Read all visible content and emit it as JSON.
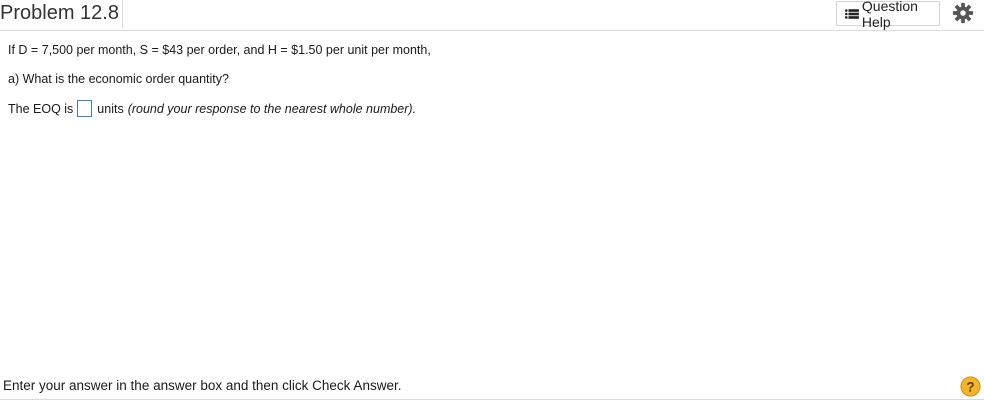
{
  "header": {
    "title": "Problem 12.8",
    "question_help_label": "Question Help",
    "question_help_icon": "list-icon",
    "settings_icon": "gear-icon"
  },
  "problem": {
    "given": "If D = 7,500 per month, S = $43 per order, and H = $1.50 per unit per month,",
    "part_a": "a) What is the economic order quantity?",
    "answer_prefix": "The EOQ is",
    "answer_value": "",
    "answer_suffix": "units",
    "answer_hint": "(round your response to the nearest whole number)."
  },
  "footer": {
    "instructions": "Enter your answer in the answer box and then click Check Answer.",
    "help_icon": "question-mark-icon"
  },
  "colors": {
    "accent_border": "#3f7fbf",
    "help_circle": "#e8a317"
  }
}
